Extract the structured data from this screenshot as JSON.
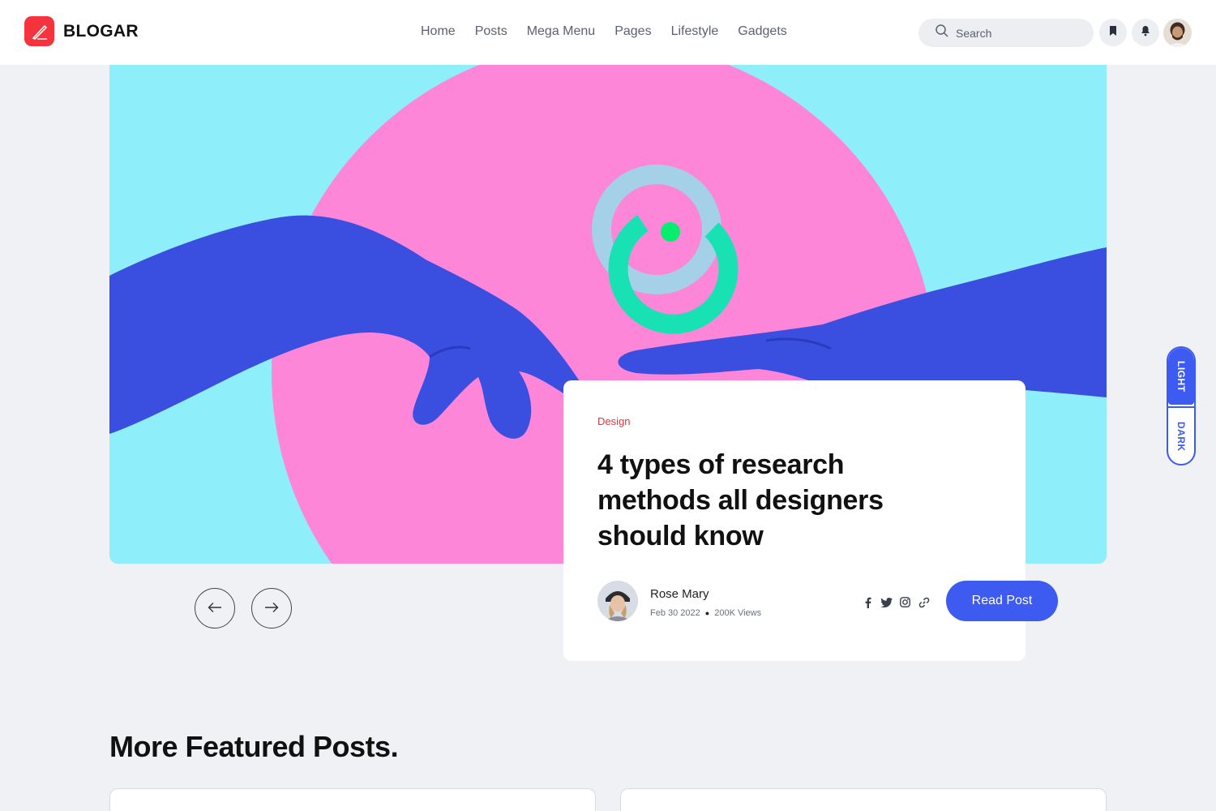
{
  "brand": {
    "name": "BLOGAR",
    "accent": "#f5333f"
  },
  "nav": {
    "items": [
      "Home",
      "Posts",
      "Mega Menu",
      "Pages",
      "Lifestyle",
      "Gadgets"
    ]
  },
  "search": {
    "placeholder": "Search"
  },
  "header_icons": [
    "bookmark-icon",
    "bell-icon"
  ],
  "hero": {
    "colors": {
      "background": "#8eeffa",
      "circle": "#fd86d8",
      "hand": "#3a4fe0"
    },
    "card": {
      "category": "Design",
      "title": "4 types of research methods all designers should know",
      "author": "Rose Mary",
      "date": "Feb 30 2022",
      "views": "200K Views",
      "socials": [
        "facebook-icon",
        "twitter-icon",
        "instagram-icon",
        "link-icon"
      ],
      "read_button": "Read Post"
    }
  },
  "section": {
    "title": "More Featured Posts."
  },
  "theme_toggle": {
    "light": "LIGHT",
    "dark": "DARK",
    "active": "light",
    "color": "#3d5af1"
  }
}
